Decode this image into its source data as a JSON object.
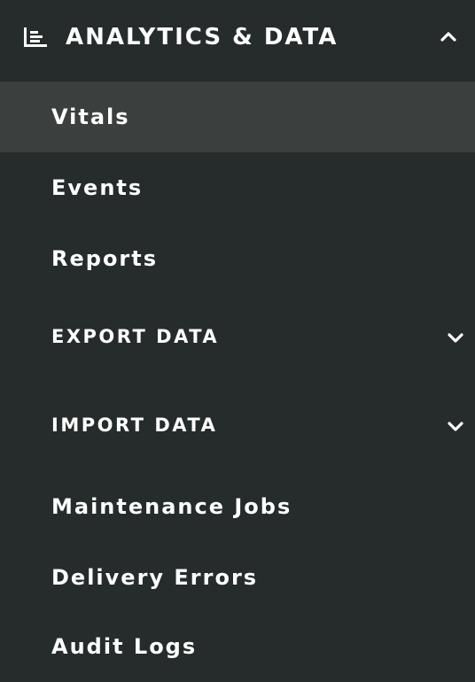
{
  "section": {
    "title": "ANALYTICS & DATA",
    "icon": "bar-chart-icon",
    "chevron": "chevron-up-icon",
    "expanded": true
  },
  "colors": {
    "background": "#262b2b",
    "active_background": "#3b403f",
    "text": "#ffffff"
  },
  "items": [
    {
      "label": "Vitals",
      "active": true
    },
    {
      "label": "Events"
    },
    {
      "label": "Reports"
    }
  ],
  "groups": [
    {
      "label": "EXPORT DATA",
      "chevron": "chevron-down-icon",
      "expanded": false
    },
    {
      "label": "IMPORT DATA",
      "chevron": "chevron-down-icon",
      "expanded": false
    }
  ],
  "bottom_items": [
    {
      "label": "Maintenance Jobs"
    },
    {
      "label": "Delivery Errors"
    },
    {
      "label": "Audit Logs"
    }
  ]
}
